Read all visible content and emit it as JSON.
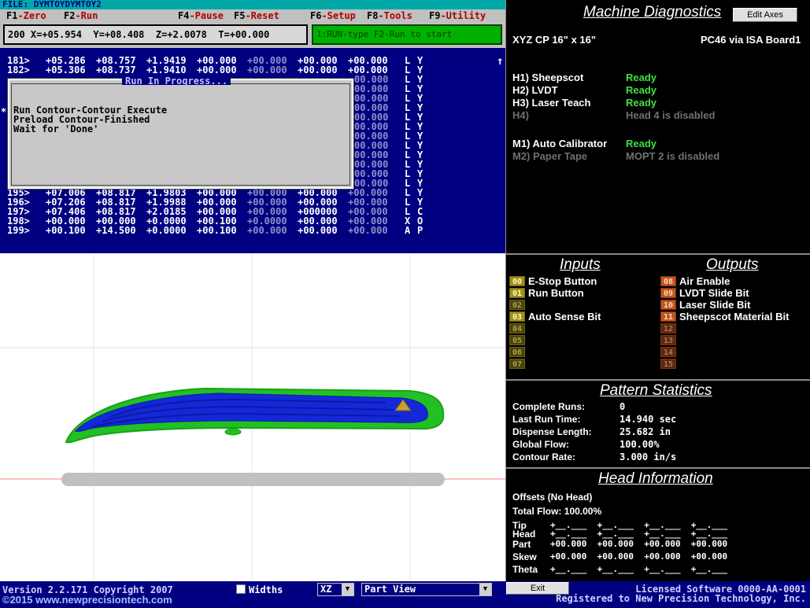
{
  "console": {
    "file_label": "FILE: DYMTOYDYMTOY2",
    "fkeys": {
      "f1": "F1",
      "f1_label": "-Zero",
      "f2": "F2",
      "f2_label": "-Run",
      "f4": "F4",
      "f4_label": "-Pause",
      "f5": "F5",
      "f5_label": "-Reset",
      "f6": "F6",
      "f6_label": "-Setup",
      "f8": "F8",
      "f8_label": "-Tools",
      "f9": "F9",
      "f9_label": "-Utility"
    },
    "position_readout": "200 X=+05.954  Y=+08.408  Z=+2.0078  T=+00.000",
    "prompt": "1:RUN-type F2-Run to start",
    "rows": [
      {
        "n": "181>",
        "x": "+05.286",
        "y": "+08.757",
        "z": "+1.9419",
        "t": "+00.000",
        "a": "+00.000",
        "b": "+00.000",
        "c": "+00.000",
        "m1": "L",
        "m2": "Y"
      },
      {
        "n": "182>",
        "x": "+05.306",
        "y": "+08.737",
        "z": "+1.9410",
        "t": "+00.000",
        "a": "+00.000",
        "b": "+00.000",
        "c": "+00.000",
        "m1": "L",
        "m2": "Y"
      },
      {
        "n": "",
        "c": "00.000",
        "m1": "L",
        "m2": "Y"
      },
      {
        "n": "",
        "c": "00.000",
        "m1": "L",
        "m2": "Y"
      },
      {
        "n": "",
        "c": "00.000",
        "m1": "L",
        "m2": "Y"
      },
      {
        "n": "",
        "c": "00.000",
        "m1": "L",
        "m2": "Y"
      },
      {
        "n": "",
        "c": "00.000",
        "m1": "L",
        "m2": "Y"
      },
      {
        "n": "",
        "c": "00.000",
        "m1": "L",
        "m2": "Y"
      },
      {
        "n": "",
        "c": "00.000",
        "m1": "L",
        "m2": "Y"
      },
      {
        "n": "",
        "c": "00.000",
        "m1": "L",
        "m2": "Y"
      },
      {
        "n": "",
        "c": "00.000",
        "m1": "L",
        "m2": "Y"
      },
      {
        "n": "",
        "c": "00.000",
        "m1": "L",
        "m2": "Y"
      },
      {
        "n": "",
        "c": "00.000",
        "m1": "L",
        "m2": "Y"
      },
      {
        "n": "",
        "c": "00.000",
        "m1": "L",
        "m2": "Y"
      },
      {
        "n": "195>",
        "x": "+07.006",
        "y": "+08.817",
        "z": "+1.9803",
        "t": "+00.000",
        "a": "+00.000",
        "b": "+00.000",
        "c": "+00.000",
        "m1": "L",
        "m2": "Y"
      },
      {
        "n": "196>",
        "x": "+07.206",
        "y": "+08.817",
        "z": "+1.9988",
        "t": "+00.000",
        "a": "+00.000",
        "b": "+00.000",
        "c": "+00.000",
        "m1": "L",
        "m2": "Y"
      },
      {
        "n": "197>",
        "x": "+07.406",
        "y": "+08.817",
        "z": "+2.0185",
        "t": "+00.000",
        "a": "+00.000",
        "b": "+000000",
        "c": "+00.000",
        "m1": "L",
        "m2": "C"
      },
      {
        "n": "198>",
        "x": "+00.000",
        "y": "+00.000",
        "z": "+0.0000",
        "t": "+00.100",
        "a": "+0.0000",
        "b": "+00.000",
        "c": "+00.000",
        "m1": "X",
        "m2": "O"
      },
      {
        "n": "199>",
        "x": "+00.100",
        "y": "+14.500",
        "z": "+0.0000",
        "t": "+00.100",
        "a": "+00.000",
        "b": "+00.000",
        "c": "+00.000",
        "m1": "A",
        "m2": "P"
      }
    ],
    "run_dialog": {
      "title": "Run In Progress...",
      "line1": "Run Contour-Contour Execute",
      "line2": "Preload Contour-Finished",
      "line3": "Wait for 'Done'"
    }
  },
  "diagnostics": {
    "title": "Machine Diagnostics",
    "edit_axes": "Edit Axes",
    "machine": "XYZ CP 16\" x 16\"",
    "board": "PC46 via ISA  Board1",
    "heads": [
      {
        "label": "H1) Sheepscot",
        "status": "Ready",
        "enabled": true
      },
      {
        "label": "H2) LVDT",
        "status": "Ready",
        "enabled": true
      },
      {
        "label": "H3) Laser Teach",
        "status": "Ready",
        "enabled": true
      },
      {
        "label": "H4)",
        "status": "Head 4 is disabled",
        "enabled": false
      }
    ],
    "modules": [
      {
        "label": "M1) Auto Calibrator",
        "status": "Ready",
        "enabled": true
      },
      {
        "label": "M2) Paper Tape",
        "status": "MOPT 2 is disabled",
        "enabled": false
      }
    ]
  },
  "io": {
    "inputs_title": "Inputs",
    "outputs_title": "Outputs",
    "inputs": [
      {
        "num": "00",
        "label": "E-Stop Button",
        "active": true
      },
      {
        "num": "01",
        "label": "Run Button",
        "active": true
      },
      {
        "num": "02",
        "label": "",
        "active": false
      },
      {
        "num": "03",
        "label": "Auto Sense Bit",
        "active": true
      },
      {
        "num": "04",
        "label": "",
        "active": false
      },
      {
        "num": "05",
        "label": "",
        "active": false
      },
      {
        "num": "06",
        "label": "",
        "active": false
      },
      {
        "num": "07",
        "label": "",
        "active": false
      }
    ],
    "outputs": [
      {
        "num": "08",
        "label": "Air Enable",
        "active": true
      },
      {
        "num": "09",
        "label": "LVDT Slide Bit",
        "active": true
      },
      {
        "num": "10",
        "label": "Laser Slide Bit",
        "active": true
      },
      {
        "num": "11",
        "label": "Sheepscot Material Bit",
        "active": true
      },
      {
        "num": "12",
        "label": "",
        "active": false
      },
      {
        "num": "13",
        "label": "",
        "active": false
      },
      {
        "num": "14",
        "label": "",
        "active": false
      },
      {
        "num": "15",
        "label": "",
        "active": false
      }
    ]
  },
  "stats": {
    "title": "Pattern Statistics",
    "items": [
      {
        "label": "Complete Runs:",
        "value": "0"
      },
      {
        "label": "Last Run Time:",
        "value": "14.940 sec"
      },
      {
        "label": "Dispense Length:",
        "value": "25.682  in"
      },
      {
        "label": "Global Flow:",
        "value": "100.00%"
      },
      {
        "label": "Contour Rate:",
        "value": "3.000 in/s"
      }
    ]
  },
  "head_info": {
    "title": "Head Information",
    "offsets": "Offsets (No Head)",
    "total_flow": "Total Flow: 100.00%",
    "tip_label": "Tip",
    "head_label": "Head",
    "part_label": "Part",
    "skew_label": "Skew",
    "theta_label": "Theta",
    "blank_row": "+__.___  +__.___  +__.___  +__.___",
    "part_row": "+00.000  +00.000  +00.000  +00.000",
    "skew_row": "+00.000  +00.000  +00.000  +00.000"
  },
  "bottom": {
    "version": "Version 2.2.171 Copyright 2007",
    "website": "©2015 www.newprecisiontech.com",
    "widths_label": "Widths",
    "axis_select": "XZ",
    "view_select": "Part View",
    "exit": "Exit",
    "license": "Licensed Software 0000-AA-0001\nRegistered to New Precision Technology, Inc."
  }
}
